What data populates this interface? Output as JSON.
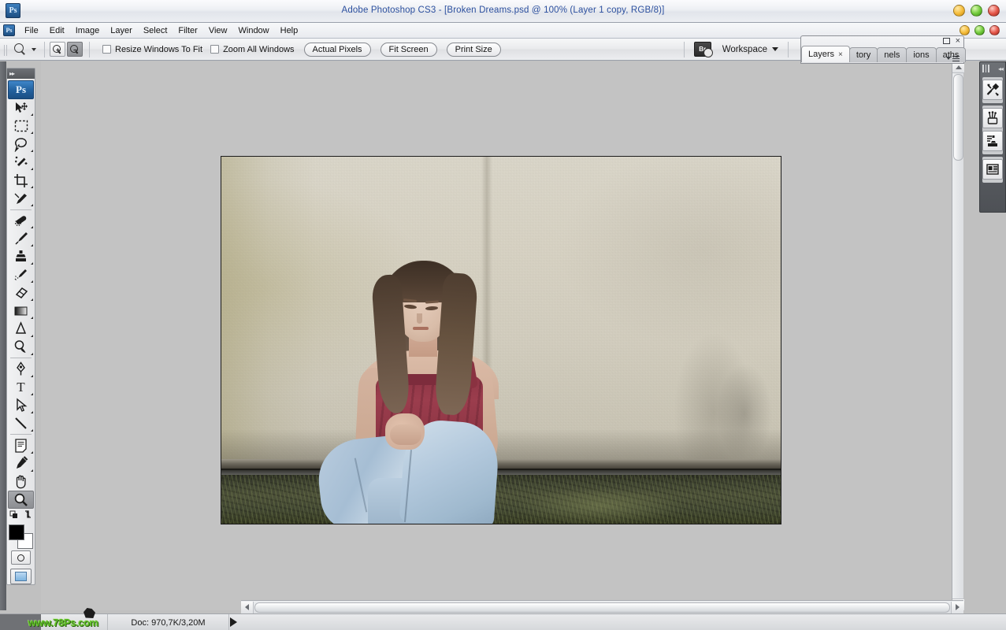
{
  "window": {
    "title": "Adobe Photoshop CS3 - [Broken Dreams.psd @ 100% (Layer 1 copy, RGB/8)]",
    "app_badge": "Ps",
    "buttons": {
      "minimize": "minimize",
      "maximize": "maximize",
      "close": "close"
    },
    "colors": {
      "minimize": "#f5bd3c",
      "maximize": "#73cc3e",
      "close": "#e5584b",
      "title_text": "#2b4f9e"
    }
  },
  "menubar": {
    "badge": "Ps",
    "items": [
      {
        "label": "File"
      },
      {
        "label": "Edit"
      },
      {
        "label": "Image"
      },
      {
        "label": "Layer"
      },
      {
        "label": "Select"
      },
      {
        "label": "Filter"
      },
      {
        "label": "View"
      },
      {
        "label": "Window"
      },
      {
        "label": "Help"
      }
    ]
  },
  "options_bar": {
    "active_tool": "zoom-tool",
    "zoom_in_label": "+",
    "zoom_out_label": "−",
    "zoom_out_active": true,
    "checkboxes": [
      {
        "label": "Resize Windows To Fit",
        "checked": false
      },
      {
        "label": "Zoom All Windows",
        "checked": false
      }
    ],
    "buttons": [
      {
        "label": "Actual Pixels"
      },
      {
        "label": "Fit Screen"
      },
      {
        "label": "Print Size"
      }
    ],
    "bridge_label": "Br",
    "workspace_label": "Workspace"
  },
  "toolbox": {
    "badge": "Ps",
    "tools": [
      {
        "name": "move-tool",
        "label": "Move Tool"
      },
      {
        "name": "marquee-tool",
        "label": "Rectangular Marquee Tool"
      },
      {
        "name": "lasso-tool",
        "label": "Lasso Tool"
      },
      {
        "name": "magic-wand-tool",
        "label": "Magic Wand Tool"
      },
      {
        "name": "crop-tool",
        "label": "Crop Tool"
      },
      {
        "name": "slice-tool",
        "label": "Slice Tool"
      },
      {
        "name": "healing-brush-tool",
        "label": "Spot Healing Brush Tool"
      },
      {
        "name": "brush-tool",
        "label": "Brush Tool"
      },
      {
        "name": "clone-stamp-tool",
        "label": "Clone Stamp Tool"
      },
      {
        "name": "history-brush-tool",
        "label": "History Brush Tool"
      },
      {
        "name": "eraser-tool",
        "label": "Eraser Tool"
      },
      {
        "name": "gradient-tool",
        "label": "Gradient Tool"
      },
      {
        "name": "blur-tool",
        "label": "Blur Tool"
      },
      {
        "name": "dodge-tool",
        "label": "Dodge Tool"
      },
      {
        "name": "pen-tool",
        "label": "Pen Tool"
      },
      {
        "name": "type-tool",
        "label": "Horizontal Type Tool"
      },
      {
        "name": "path-selection-tool",
        "label": "Path Selection Tool"
      },
      {
        "name": "line-tool",
        "label": "Line Tool"
      },
      {
        "name": "notes-tool",
        "label": "Notes Tool"
      },
      {
        "name": "eyedropper-tool",
        "label": "Eyedropper Tool"
      },
      {
        "name": "hand-tool",
        "label": "Hand Tool"
      },
      {
        "name": "zoom-tool",
        "label": "Zoom Tool",
        "selected": true
      }
    ],
    "type_glyph": "T",
    "colors": {
      "foreground": "#000000",
      "background": "#ffffff"
    },
    "quick_mask_label": "Edit in Quick Mask Mode",
    "screen_mode_label": "Change Screen Mode"
  },
  "layers_panel": {
    "tabs": [
      {
        "label": "Layers",
        "active": true,
        "closable": true,
        "close_glyph": "×"
      },
      {
        "label": "tory",
        "active": false
      },
      {
        "label": "nels",
        "active": false
      },
      {
        "label": "ions",
        "active": false
      },
      {
        "label": "aths",
        "active": false
      }
    ],
    "close_glyph": "×"
  },
  "right_dock": {
    "items": [
      {
        "name": "tool-presets-icon",
        "label": "Tool Presets"
      },
      {
        "name": "brushes-icon",
        "label": "Brushes"
      },
      {
        "name": "clone-source-icon",
        "label": "Clone Source"
      },
      {
        "name": "layer-comps-icon",
        "label": "Layer Comps"
      }
    ]
  },
  "document": {
    "zoom": "100%",
    "filename": "Broken Dreams.psd",
    "layer": "Layer 1 copy",
    "mode": "RGB/8",
    "image_description": "Young woman in burgundy tank top and light blue jeans sitting on grass against a textured beige stucco wall, head lowered"
  },
  "status_bar": {
    "watermark": "www.78Ps.com",
    "doc_info": "Doc: 970,7K/3,20M"
  }
}
